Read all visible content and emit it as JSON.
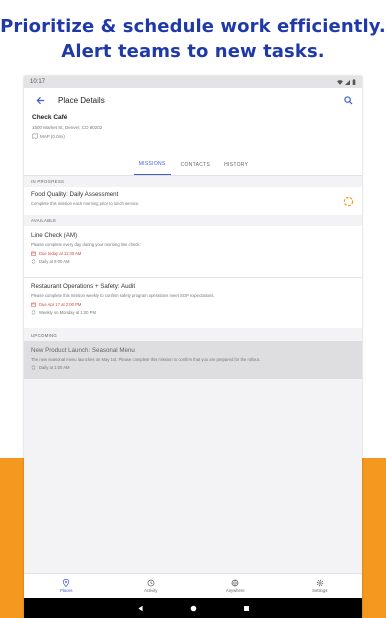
{
  "headline": {
    "line1": "Prioritize & schedule work efficiently.",
    "line2": "Alert teams to new tasks."
  },
  "status_bar": {
    "time": "10:17"
  },
  "app_bar": {
    "title": "Place Details",
    "back_icon": "arrow-back-icon",
    "search_icon": "search-icon"
  },
  "place": {
    "name": "Check Café",
    "address": "1500 Market St, Denver, CO 80202",
    "map_label": "MAP (0.0mi)"
  },
  "tabs": [
    {
      "label": "MISSIONS",
      "active": true
    },
    {
      "label": "CONTACTS",
      "active": false
    },
    {
      "label": "HISTORY",
      "active": false
    }
  ],
  "sections": {
    "in_progress": "IN PROGRESS",
    "available": "AVAILABLE",
    "upcoming": "UPCOMING"
  },
  "in_progress": [
    {
      "title": "Food Quality: Daily Assessment",
      "desc": "Complete this mission each morning prior to lunch service."
    }
  ],
  "available": [
    {
      "title": "Line Check (AM)",
      "desc": "Please complete every day during your morning line check.",
      "due": "Due today at 11:30 AM",
      "repeat": "Daily at 9:00 AM"
    },
    {
      "title": "Restaurant Operations + Safety: Audit",
      "desc": "Please complete this mission weekly to confirm safety program operations meet SOP expectations.",
      "due": "Due Apr 17 at 2:00 PM",
      "repeat": "Weekly on Monday at 1:00 PM"
    }
  ],
  "upcoming": [
    {
      "title": "New Product Launch: Seasonal Menu",
      "desc": "The new seasonal menu launches on May 1st. Please complete this mission to confirm that you are prepared for the rollout.",
      "repeat": "Daily at 1:00 AM"
    }
  ],
  "bottom_nav": [
    {
      "label": "Places",
      "icon": "location-pin-icon",
      "active": true
    },
    {
      "label": "Activity",
      "icon": "history-icon",
      "active": false
    },
    {
      "label": "Anywhere",
      "icon": "globe-icon",
      "active": false
    },
    {
      "label": "Settings",
      "icon": "gear-icon",
      "active": false
    }
  ],
  "colors": {
    "brand_blue": "#1f3aa8",
    "accent": "#3f5fd0",
    "orange": "#f4981f",
    "due_red": "#d04a3a"
  }
}
